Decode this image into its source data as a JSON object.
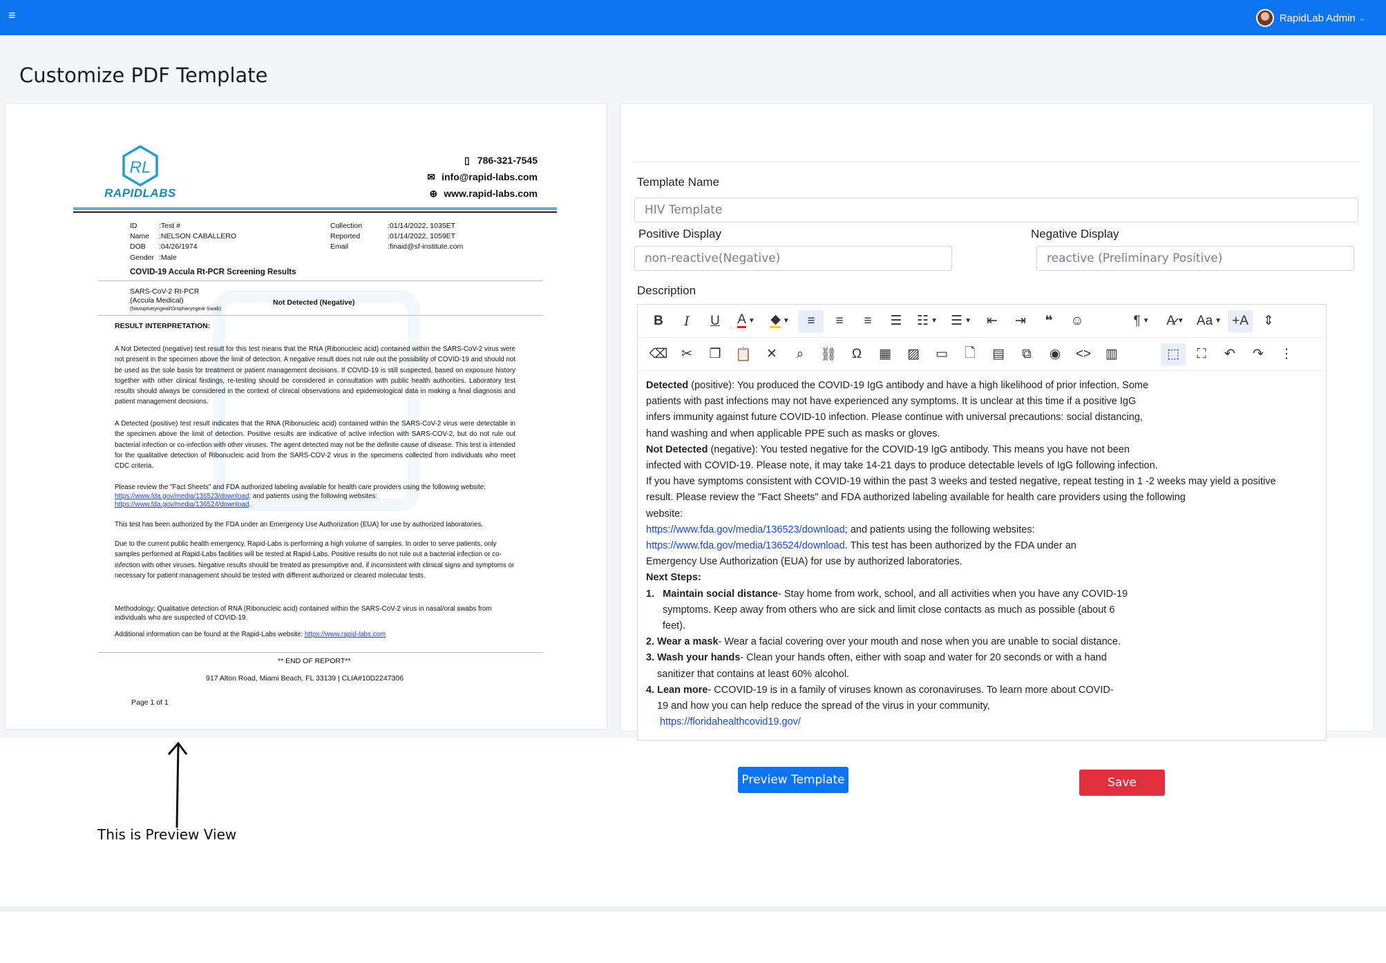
{
  "topbar": {
    "menu_icon": "hamburger-icon",
    "user_name": "RapidLab Admin",
    "color": "#0d74f0"
  },
  "page": {
    "title": "Customize PDF Template"
  },
  "preview": {
    "logo_text": "RAPIDLABS",
    "phone": "786-321-7545",
    "email": "info@rapid-labs.com",
    "website": "www.rapid-labs.com",
    "id_label": "ID",
    "id_value": ":Test #",
    "name_label": "Name",
    "name_value": ":NELSON CABALLERO",
    "dob_label": "DOB",
    "dob_value": ":04/26/1974",
    "gender_label": "Gender",
    "gender_value": ":Male",
    "collection_label": "Collection",
    "collection_value": ":01/14/2022, 1035ET",
    "reported_label": "Reported",
    "reported_value": ":01/14/2022, 1059ET",
    "email_label": "Email",
    "email_value": ":finaid@sf-institute.com",
    "results_heading": "COVID-19 Accula Rt-PCR Screening Results",
    "test_name": "SARS-CoV-2 Rt-PCR",
    "test_sub1": "(Accula Medical)",
    "test_sub2": "(Nasopharyngeal/Oropharyngeal Swab)",
    "test_result": "Not Detected (Negative)",
    "interp_heading": "RESULT INTERPRETATION:",
    "p1": "A Not Detected (negative) test result for this test means that the RNA (Ribonucleic acid) contained within the SARS-CoV-2 virus were not present in the specimen above the limit of detection. A negative result does not rule out the possibility of COVID-19 and should not be used as the sole basis for treatment or patient management decisions. If COVID-19 is still suspected, based on exposure history together with other clinical findings, re-testing should be considered in consultation with public health authorities. Laboratory test results should always be considered in the context of clinical observations and epidemiological data in making a final diagnosis and patient management decisions.",
    "p2": "A Detected (positive) test result indicates that the RNA (Ribonucleic acid) contained within the SARS-CoV-2 virus were detectable in the specimen above the limit of detection. Positive results are indicative of active infection with SARS-COV-2, but do not rule out bacterial infection or co-infection with other viruses. The agent detected may not be the definite cause of disease. This test is intended for the qualitative detection of Ribonucleic acid from the SARS-COV-2 virus in the specimens collected from individuals who meet CDC criteria.",
    "p3_pre": "Please review the \"Fact Sheets\" and FDA authorized labeling available for health care providers using the following website:",
    "p3_link1": "https://www.fda.gov/media/136523/download",
    "p3_mid": "; and patients using the following websites:",
    "p3_link2": "https://www.fda.gov/media/136524/download",
    "p3_end": ".",
    "p4": "This test has been authorized by the FDA under an Emergency Use Authorization (EUA) for use by authorized laboratories.",
    "p5": "Due to the current public health emergency, Rapid-Labs is performing a high volume of samples. In order to serve patients, only samples performed at Rapid-Labs facilities will be tested at Rapid-Labs. Positive results do not rule out a bacterial infection or co-infection with other viruses. Negative results should be treated as presumptive and, if inconsistent with clinical signs and symptoms or necessary for patient management should be tested with different authorized or cleared molecular tests.",
    "p6": "Methodology: Qualitative detection of RNA (Ribonucleic acid) contained within the SARS-CoV-2 virus in nasal/oral swabs from individuals who are suspected of COVID-19.",
    "p7_pre": "Additional information can be found at the Rapid-Labs website:",
    "p7_link": "https://www.rapid-labs.com",
    "end_report": "** END OF REPORT**",
    "address": "917 Alton Road, Miami Beach, FL 33139 | CLIA#10D2247306",
    "page_num": "Page 1 of 1"
  },
  "form": {
    "template_name_label": "Template Name",
    "template_name_value": "HIV Template",
    "positive_label": "Positive Display",
    "positive_value": "non-reactive(Negative)",
    "negative_label": "Negative  Display",
    "negative_value": "reactive (Preliminary Positive)",
    "description_label": "Description"
  },
  "toolbar": {
    "row1": [
      "bold-icon",
      "italic-icon",
      "underline-icon",
      "font-color-icon",
      "highlight-icon",
      "align-left-icon",
      "align-center-icon",
      "align-right-icon",
      "justify-icon",
      "ordered-list-icon",
      "unordered-list-icon",
      "outdent-icon",
      "indent-icon",
      "blockquote-icon",
      "emoji-icon",
      "paragraph-format-icon",
      "font-size-icon",
      "text-case-icon",
      "clear-format-icon",
      "line-height-icon"
    ],
    "row2": [
      "eraser-icon",
      "cut-icon",
      "copy-icon",
      "paste-icon",
      "remove-format-icon",
      "search-icon",
      "link-icon",
      "special-char-icon",
      "table-icon",
      "image-icon",
      "video-icon",
      "file-icon",
      "template-icon",
      "embed-icon",
      "preview-icon",
      "code-view-icon",
      "select-all-icon",
      "block-select-icon",
      "fullscreen-icon",
      "undo-icon",
      "redo-icon",
      "more-icon"
    ]
  },
  "description": {
    "l1_b": "Detected",
    "l1": " (positive): You produced the COVID-19 IgG antibody and have a high likelihood of prior infection. Some",
    "l2": "patients with past infections may not have experienced any symptoms. It is unclear at this time if a positive IgG",
    "l3": "infers immunity against future COVID-10 infection. Please continue with universal precautions: social distancing,",
    "l4": "hand washing and when applicable PPE such as masks or gloves.",
    "l5_b": "Not Detected",
    "l5": " (negative): You tested negative for the COVID-19 IgG antibody. This means you have not been",
    "l6": "infected with COVID-19. Please note, it may take 14-21 days to produce detectable levels of IgG following infection.",
    "l7": "If you have symptoms consistent with COVID-19 within the past 3 weeks and tested negative, repeat testing in 1 -2 weeks may yield a positive",
    "l8": "result. Please review the \"Fact Sheets\" and FDA authorized labeling available for health care providers using the following",
    "l9": "website:",
    "l10_link": "https://www.fda.gov/media/136523/download",
    "l10": "; and patients using the following websites:",
    "l11_link": "https://www.fda.gov/media/136524/download",
    "l11": ". This test has been authorized by the FDA under an",
    "l12": "Emergency Use Authorization (EUA) for use by authorized laboratories.",
    "l13_b": "Next Steps:",
    "s1_num": "1.",
    "s1_b": "Maintain social distance",
    "s1": "- Stay home from work, school, and all activities when you have any COVID-19",
    "s1b": "symptoms. Keep away from others who are sick and limit close contacts as much as possible (about 6",
    "s1c": "feet).",
    "s2_b": "2. Wear a mask",
    "s2": "- Wear a facial covering over your mouth and nose when you are unable to social distance.",
    "s3_b": "3. Wash your hands",
    "s3": "- Clean your hands often, either with soap and water for 20 seconds or with a hand",
    "s3b": "sanitizer that contains at least 60% alcohol.",
    "s4_b": "4. Lean more",
    "s4": "- CCOVID-19 is in a family of viruses known as coronaviruses. To learn more about COVID-",
    "s4b": "19 and how you can help reduce the spread of the virus in your community,",
    "s4_link": "https://floridahealthcovid19.gov/"
  },
  "buttons": {
    "preview": "Preview Template",
    "save": "Save",
    "preview_color": "#0d74f0",
    "save_color": "#e0303f"
  },
  "annotation": {
    "text": "This is Preview View"
  }
}
